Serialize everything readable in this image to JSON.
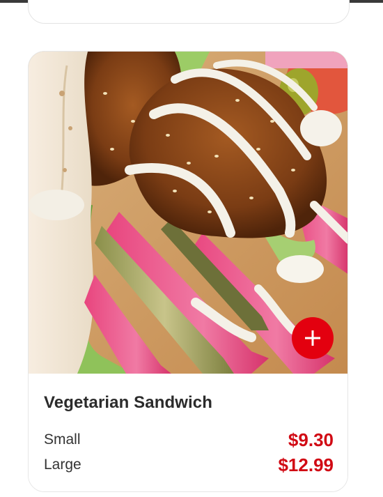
{
  "item": {
    "name": "Vegetarian Sandwich",
    "image_alt": "Falafel sandwich with pita, pickled turnips, pickles, lettuce and tahini sauce",
    "add_button_icon": "plus-icon",
    "sizes": [
      {
        "label": "Small",
        "price": "$9.30"
      },
      {
        "label": "Large",
        "price": "$12.99"
      }
    ]
  },
  "colors": {
    "accent": "#e3000f",
    "price": "#d10a14",
    "title": "#2b2b2b"
  }
}
